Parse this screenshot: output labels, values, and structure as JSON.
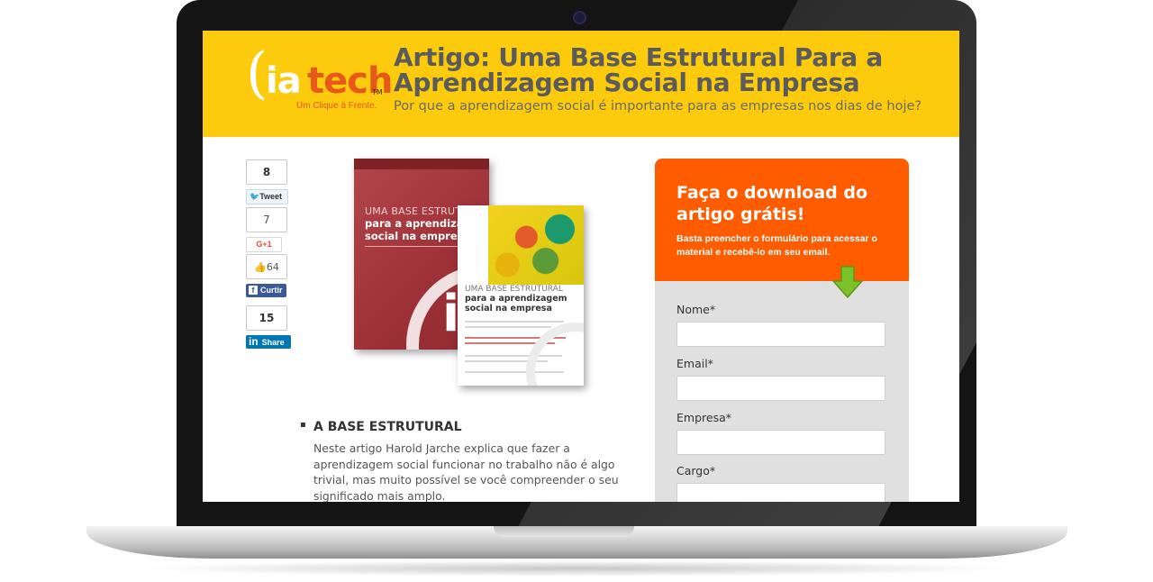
{
  "header": {
    "title": "Artigo: Uma Base Estrutural Para a Aprendizagem Social na Empresa",
    "subtitle": "Por que a aprendizagem social é importante para as empresas nos dias de hoje?",
    "brand_color": "#fccb0d"
  },
  "logo": {
    "paren": "(",
    "ia": "ia",
    "tech": "tech",
    "tm": "TM",
    "slogan": "Um Clique à Frente."
  },
  "share": {
    "twitter": {
      "count": "8",
      "label": "Tweet",
      "icon": "twitter-bird-icon"
    },
    "google": {
      "count": "7",
      "label": "G+1"
    },
    "facebook": {
      "count": "64",
      "label": "Curtir",
      "icon": "thumbs-up-icon"
    },
    "linkedin": {
      "count": "15",
      "label": "Share",
      "icon": "linkedin-icon"
    }
  },
  "book": {
    "line1": "UMA BASE ESTRUTURAL",
    "line2": "para a aprendizagem",
    "line3": "social na empresa",
    "mark": "ia"
  },
  "article": {
    "section_title": "A BASE ESTRUTURAL",
    "section_body": "Neste artigo Harold Jarche explica que fazer a aprendizagem social funcionar no trabalho não é algo trivial, mas muito possível se você compreender o seu significado mais amplo."
  },
  "form": {
    "title": "Faça o download do artigo grátis!",
    "description": "Basta preencher o formulário para acessar o material e recebê-lo em seu email.",
    "accent_color": "#ff5c00",
    "fields": [
      {
        "label": "Nome*",
        "value": ""
      },
      {
        "label": "Email*",
        "value": ""
      },
      {
        "label": "Empresa*",
        "value": ""
      },
      {
        "label": "Cargo*",
        "value": ""
      }
    ]
  }
}
